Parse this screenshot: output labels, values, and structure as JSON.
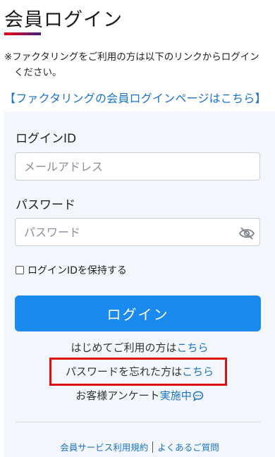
{
  "header": {
    "title": "会員ログイン"
  },
  "notice": {
    "line1": "※ファクタリングをご利用の方は以下のリンクからログイン",
    "line2": "ください。"
  },
  "member_login_link": "【ファクタリングの会員ログインページはこちら】",
  "form": {
    "login_id_label": "ログインID",
    "login_id_placeholder": "メールアドレス",
    "password_label": "パスワード",
    "password_placeholder": "パスワード",
    "remember_label": "ログインIDを保持する",
    "login_button": "ログイン"
  },
  "links": {
    "first_time_prefix": "はじめてご利用の方は",
    "first_time_link": "こちら",
    "forgot_prefix": "パスワードを忘れた方は",
    "forgot_link": "こちら",
    "survey_prefix": "お客様アンケート",
    "survey_link": "実施中",
    "survey_icon": "chat-bubble-icon"
  },
  "footer": {
    "terms": "会員サービス利用規約",
    "faq": "よくあるご質問"
  },
  "colors": {
    "accent": "#1a8af0",
    "link": "#1a73c8",
    "highlight_border": "#e00d0d",
    "panel_bg": "#f3f6fa"
  }
}
